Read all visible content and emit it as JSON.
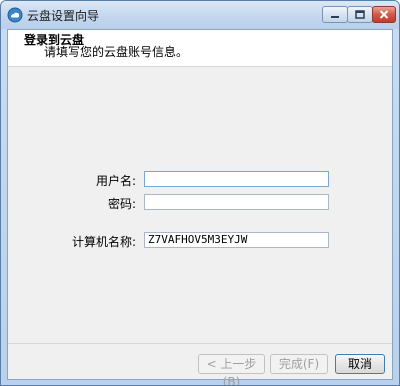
{
  "window": {
    "title": "云盘设置向导"
  },
  "header": {
    "title": "登录到云盘",
    "subtitle": "请填写您的云盘账号信息。"
  },
  "form": {
    "username_label": "用户名:",
    "username_value": "",
    "password_label": "密码:",
    "password_value": "",
    "computer_label": "计算机名称:",
    "computer_value": "Z7VAFHOV5M3EYJW"
  },
  "buttons": {
    "back": "< 上一步(B)",
    "finish": "完成(F)",
    "cancel": "取消"
  },
  "colors": {
    "accent": "#3c7fb1",
    "titlebar": "#c2d6ee",
    "close": "#c43a2a"
  },
  "icons": [
    "cloud-setup-icon",
    "minimize-icon",
    "maximize-icon",
    "close-icon"
  ]
}
